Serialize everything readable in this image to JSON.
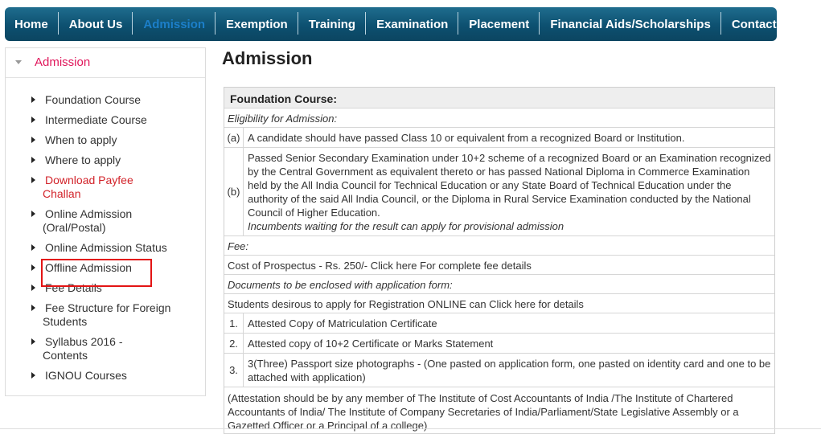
{
  "nav": {
    "items": [
      {
        "label": "Home"
      },
      {
        "label": "About Us"
      },
      {
        "label": "Admission",
        "active": true
      },
      {
        "label": "Exemption"
      },
      {
        "label": "Training"
      },
      {
        "label": "Examination"
      },
      {
        "label": "Placement"
      },
      {
        "label": "Financial Aids/Scholarships"
      },
      {
        "label": "Contact"
      }
    ],
    "active_color": "#1c7fc9",
    "bar_color": "#0d5070"
  },
  "sidebar": {
    "title": "Admission",
    "title_color": "#e0175b",
    "items": [
      {
        "label": "Foundation Course"
      },
      {
        "label": "Intermediate Course"
      },
      {
        "label": "When to apply"
      },
      {
        "label": "Where to apply"
      },
      {
        "label": "Download Payfee Challan",
        "color": "#d2232a"
      },
      {
        "label": "Online Admission (Oral/Postal)",
        "highlighted": true
      },
      {
        "label": "Online Admission Status"
      },
      {
        "label": "Offline Admission"
      },
      {
        "label": "Fee Details"
      },
      {
        "label": "Fee Structure for Foreign Students"
      },
      {
        "label": "Syllabus 2016 - Contents"
      },
      {
        "label": "IGNOU Courses"
      }
    ]
  },
  "main": {
    "title": "Admission",
    "section_heading": "Foundation Course:",
    "eligibility_label": "Eligibility for Admission:",
    "eligibility": [
      {
        "num": "(a)",
        "text": "A candidate should have passed Class 10 or equivalent from a recognized Board or Institution."
      },
      {
        "num": "(b)",
        "text": "Passed Senior Secondary Examination under 10+2 scheme of a recognized Board or an Examination recognized by the Central Government as equivalent thereto or has passed National Diploma in Commerce Examination held by the All India Council for Technical Education or any State Board of Technical Education under the authority of the said All India Council, or the Diploma in Rural Service Examination conducted by the National Council of Higher Education.",
        "note": "Incumbents waiting for the result can apply for provisional admission"
      }
    ],
    "fee_label": "Fee:",
    "fee_text": "Cost of Prospectus - Rs. 250/-  Click here For complete fee details",
    "documents_label": "Documents to be enclosed with application form:",
    "online_text": "Students desirous to apply for Registration ONLINE can  Click here for details",
    "documents": [
      {
        "num": "1.",
        "text": "Attested Copy of Matriculation Certificate"
      },
      {
        "num": "2.",
        "text": "Attested copy of 10+2 Certificate or Marks Statement"
      },
      {
        "num": "3.",
        "text": "3(Three) Passport size photographs - (One pasted on application form, one pasted on identity card and one to be attached with application)"
      }
    ],
    "attestation_note": "(Attestation should be by any member of The Institute of Cost Accountants of India /The Institute of Chartered Accountants of India/ The Institute of Company Secretaries of India/Parliament/State Legislative Assembly or a Gazetted Officer or a Principal of a college)"
  }
}
